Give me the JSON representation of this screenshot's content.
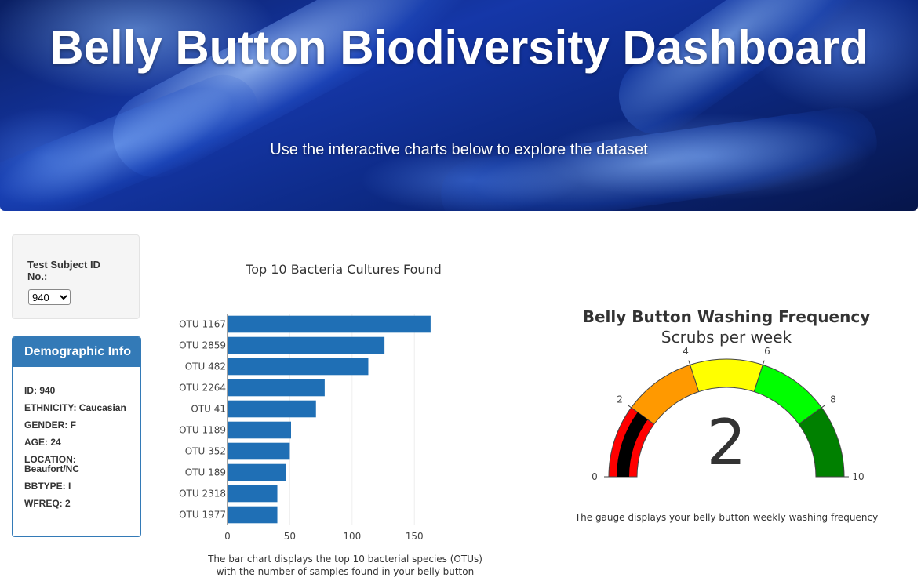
{
  "header": {
    "title": "Belly Button Biodiversity Dashboard",
    "subtitle": "Use the interactive charts below to explore the dataset"
  },
  "selector": {
    "label": "Test Subject ID No.:",
    "selected": "940",
    "options": [
      "940"
    ]
  },
  "demographic": {
    "title": "Demographic Info",
    "items": [
      "ID: 940",
      "ETHNICITY: Caucasian",
      "GENDER: F",
      "AGE: 24",
      "LOCATION: Beaufort/NC",
      "BBTYPE: I",
      "WFREQ: 2"
    ]
  },
  "bar_note": "The bar chart displays the top 10 bacterial species (OTUs) with the number of samples found in your belly button",
  "gauge_note": "The gauge displays your belly button weekly washing frequency",
  "chart_data": [
    {
      "type": "bar",
      "orientation": "horizontal",
      "title": "Top 10 Bacteria Cultures Found",
      "categories": [
        "OTU 1167",
        "OTU 2859",
        "OTU 482",
        "OTU 2264",
        "OTU 41",
        "OTU 1189",
        "OTU 352",
        "OTU 189",
        "OTU 2318",
        "OTU 1977"
      ],
      "values": [
        163,
        126,
        113,
        78,
        71,
        51,
        50,
        47,
        40,
        40
      ],
      "xticks": [
        0,
        50,
        100,
        150
      ],
      "xlim": [
        0,
        170
      ],
      "color": "#1f6fb5",
      "grid": true
    },
    {
      "type": "gauge",
      "title": "Belly Button Washing Frequency",
      "subtitle": "Scrubs per week",
      "value": 2,
      "range": [
        0,
        10
      ],
      "ticks": [
        0,
        2,
        4,
        6,
        8,
        10
      ],
      "bands": [
        {
          "from": 0,
          "to": 2,
          "color": "#ff0000"
        },
        {
          "from": 2,
          "to": 4,
          "color": "#ff9900"
        },
        {
          "from": 4,
          "to": 6,
          "color": "#ffff00"
        },
        {
          "from": 6,
          "to": 8,
          "color": "#00ff00"
        },
        {
          "from": 8,
          "to": 10,
          "color": "#008000"
        }
      ],
      "bar_color": "#000000"
    }
  ]
}
